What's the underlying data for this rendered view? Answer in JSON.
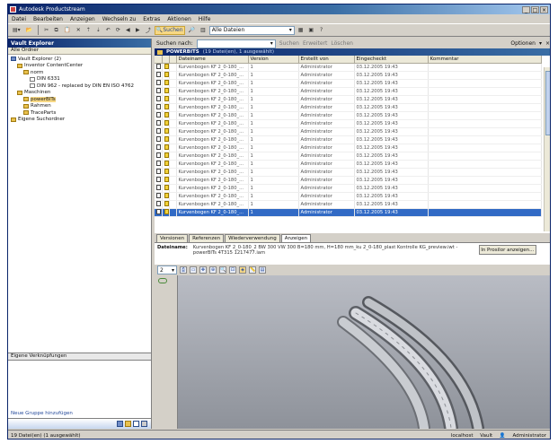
{
  "window": {
    "title": "Autodesk Productstream"
  },
  "menu": [
    "Datei",
    "Bearbeiten",
    "Anzeigen",
    "Wechseln zu",
    "Extras",
    "Aktionen",
    "Hilfe"
  ],
  "toolbar": {
    "highlight_label": "Suchen",
    "combo_value": "Alle Dateien"
  },
  "left": {
    "header": "Vault Explorer",
    "subheader": "Alle Ordner",
    "tree": [
      {
        "label": "Vault Explorer (2)",
        "indent": 0,
        "icon": "vault"
      },
      {
        "label": "Inventor ContentCenter",
        "indent": 1,
        "icon": "folder"
      },
      {
        "label": "norm",
        "indent": 2,
        "icon": "folder"
      },
      {
        "label": "DIN 6331",
        "indent": 3,
        "icon": "doc"
      },
      {
        "label": "DIN 962 - replaced by DIN EN ISO 4762",
        "indent": 3,
        "icon": "doc"
      },
      {
        "label": "Maschinen",
        "indent": 1,
        "icon": "folder"
      },
      {
        "label": "powerBITs",
        "indent": 2,
        "icon": "folder",
        "selected": true
      },
      {
        "label": "Rahmen",
        "indent": 2,
        "icon": "folder"
      },
      {
        "label": "TraceParts",
        "indent": 2,
        "icon": "folder"
      },
      {
        "label": "Eigene Suchordner",
        "indent": 0,
        "icon": "folder"
      }
    ],
    "links_header": "Eigene Verknüpfungen",
    "new_group_link": "Neue Gruppe hinzufügen"
  },
  "search": {
    "label": "Suchen nach:",
    "find": "Suchen",
    "advanced": "Erweitert",
    "delete": "Löschen",
    "options": "Optionen"
  },
  "folder_header": {
    "title": "POWERBITS",
    "subtitle": "(19 Datei(en), 1 ausgewählt)"
  },
  "table": {
    "columns": [
      "",
      "",
      "",
      "Dateiname",
      "Version",
      "Erstellt von",
      "Eingecheckt",
      "Kommentar"
    ],
    "rows": [
      [
        "Kurvenbogen KF 2_0-180_...",
        "1",
        "Administrator",
        "03.12.2005 19:43"
      ],
      [
        "Kurvenbogen KF 2_0-180_...",
        "1",
        "Administrator",
        "03.12.2005 19:43"
      ],
      [
        "Kurvenbogen KF 2_0-180_...",
        "1",
        "Administrator",
        "03.12.2005 19:43"
      ],
      [
        "Kurvenbogen KF 2_0-180_...",
        "1",
        "Administrator",
        "03.12.2005 19:43"
      ],
      [
        "Kurvenbogen KF 2_0-180_...",
        "1",
        "Administrator",
        "03.12.2005 19:43"
      ],
      [
        "Kurvenbogen KF 2_0-180_...",
        "1",
        "Administrator",
        "03.12.2005 19:43"
      ],
      [
        "Kurvenbogen KF 2_0-180_...",
        "1",
        "Administrator",
        "03.12.2005 19:43"
      ],
      [
        "Kurvenbogen KF 2_0-180_...",
        "1",
        "Administrator",
        "03.12.2005 19:43"
      ],
      [
        "Kurvenbogen KF 2_0-180_...",
        "1",
        "Administrator",
        "03.12.2005 19:43"
      ],
      [
        "Kurvenbogen KF 2_0-180_...",
        "1",
        "Administrator",
        "03.12.2005 19:43"
      ],
      [
        "Kurvenbogen KF 2_0-180_...",
        "1",
        "Administrator",
        "03.12.2005 19:43"
      ],
      [
        "Kurvenbogen KF 2_0-180_...",
        "1",
        "Administrator",
        "03.12.2005 19:43"
      ],
      [
        "Kurvenbogen KF 2_0-180_...",
        "1",
        "Administrator",
        "03.12.2005 19:43"
      ],
      [
        "Kurvenbogen KF 2_0-180_...",
        "1",
        "Administrator",
        "03.12.2005 19:43"
      ],
      [
        "Kurvenbogen KF 2_0-180_...",
        "1",
        "Administrator",
        "03.12.2005 19:43"
      ],
      [
        "Kurvenbogen KF 2_0-180_...",
        "1",
        "Administrator",
        "03.12.2005 19:43"
      ],
      [
        "Kurvenbogen KF 2_0-180_...",
        "1",
        "Administrator",
        "03.12.2005 19:43"
      ],
      [
        "Kurvenbogen KF 2_0-180_...",
        "1",
        "Administrator",
        "03.12.2005 19:43"
      ],
      [
        "Kurvenbogen KF 2_0-180_...",
        "1",
        "Administrator",
        "03.12.2005 19:43"
      ]
    ],
    "selected_row": 18
  },
  "tabs": [
    "Versionen",
    "Referenzen",
    "Wiederverwendung",
    "Anzeigen"
  ],
  "active_tab": 3,
  "detail": {
    "label": "Dateiname:",
    "value": "Kurvenbogen KF 2_0-180_2 BW 300 VW 300 B=180 mm, H=180 mm_ku 2_0-180_plast Kontrolle KG_preview.iwt - powerBITs 4T315 1217477.iam",
    "button": "In Prosilor anzeigen..."
  },
  "viewer": {
    "zoom": "2"
  },
  "status": {
    "left": "19 Datei(en) (1 ausgewählt)",
    "server": "localhost",
    "vault": "Vault",
    "user": "Administrator"
  }
}
